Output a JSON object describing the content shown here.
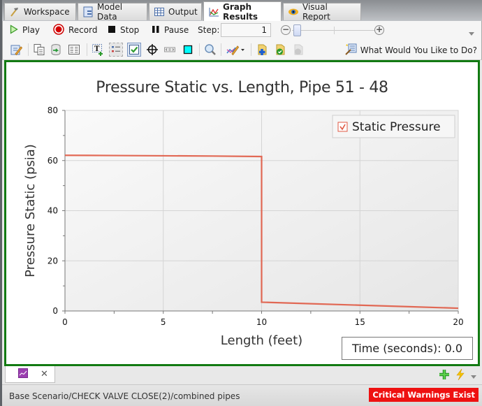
{
  "tabs": [
    {
      "label": "Workspace",
      "icon": "workspace-icon",
      "active": false
    },
    {
      "label": "Model Data",
      "icon": "model-data-icon",
      "active": false
    },
    {
      "label": "Output",
      "icon": "output-table-icon",
      "active": false
    },
    {
      "label": "Graph Results",
      "icon": "graph-results-icon",
      "active": true
    },
    {
      "label": "Visual Report",
      "icon": "visual-report-eye-icon",
      "active": false
    }
  ],
  "playback": {
    "play_label": "Play",
    "record_label": "Record",
    "stop_label": "Stop",
    "pause_label": "Pause",
    "step_label": "Step:",
    "step_value": "1",
    "slider_position": 0.0
  },
  "toolbar2": {
    "what_would_you_like": "What Would You Like to Do?"
  },
  "chart_data": {
    "type": "line",
    "title": "Pressure Static vs. Length, Pipe 51 - 48",
    "xlabel": "Length (feet)",
    "ylabel": "Pressure Static (psia)",
    "xlim": [
      0,
      20
    ],
    "ylim": [
      0,
      80
    ],
    "x_ticks": [
      "0",
      "5",
      "10",
      "15",
      "20"
    ],
    "y_ticks": [
      "0",
      "20",
      "40",
      "60",
      "80"
    ],
    "grid": true,
    "legend_placement": "top-right",
    "series": [
      {
        "name": "Static Pressure",
        "color": "#e05a44",
        "x": [
          0,
          2.5,
          5,
          7.5,
          10,
          10,
          12.5,
          15,
          17.5,
          20
        ],
        "y": [
          62.1,
          62.0,
          61.9,
          61.8,
          61.6,
          3.5,
          2.9,
          2.3,
          1.7,
          1.1
        ]
      }
    ]
  },
  "time_display": "Time (seconds): 0.0",
  "status": {
    "path": "Base Scenario/CHECK VALVE CLOSE(2)/combined pipes",
    "warning": "Critical Warnings Exist"
  },
  "colors": {
    "panel_border": "#127a12",
    "warning_bg": "#ee1111",
    "series": "#e05a44"
  }
}
